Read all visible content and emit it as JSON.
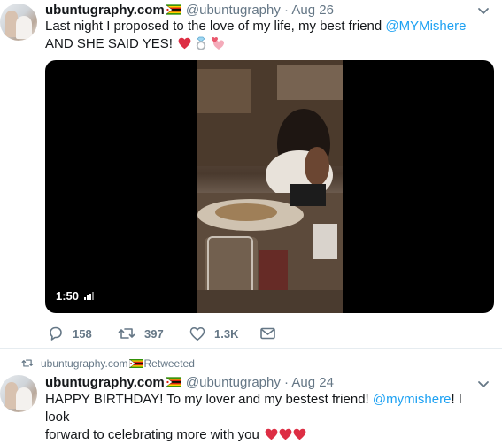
{
  "tweet1": {
    "name": "ubuntugraphy.com",
    "handle": "@ubuntugraphy",
    "separator": "·",
    "date": "Aug 26",
    "line1_prefix": "Last night I proposed to the love of my life, my best friend ",
    "line1_mention": "@MYMishere",
    "line2": "AND SHE SAID YES!",
    "emoji": [
      "red-heart",
      "ring",
      "two-hearts"
    ],
    "video": {
      "duration": "1:50"
    },
    "actions": {
      "replies": "158",
      "retweets": "397",
      "likes": "1.3K"
    }
  },
  "retweet_context": {
    "user": "ubuntugraphy.com",
    "label": "Retweeted"
  },
  "tweet2": {
    "name": "ubuntugraphy.com",
    "handle": "@ubuntugraphy",
    "separator": "·",
    "date": "Aug 24",
    "line1_prefix": "HAPPY BIRTHDAY! To my lover and my bestest friend! ",
    "line1_mention": "@mymishere",
    "line1_suffix": "! I look",
    "line2": "forward to celebrating more with you",
    "emoji": [
      "red-heart",
      "red-heart",
      "red-heart"
    ]
  },
  "colors": {
    "accent": "#1da1f2",
    "muted": "#657786",
    "text": "#14171a",
    "heart": "#e0245e"
  }
}
